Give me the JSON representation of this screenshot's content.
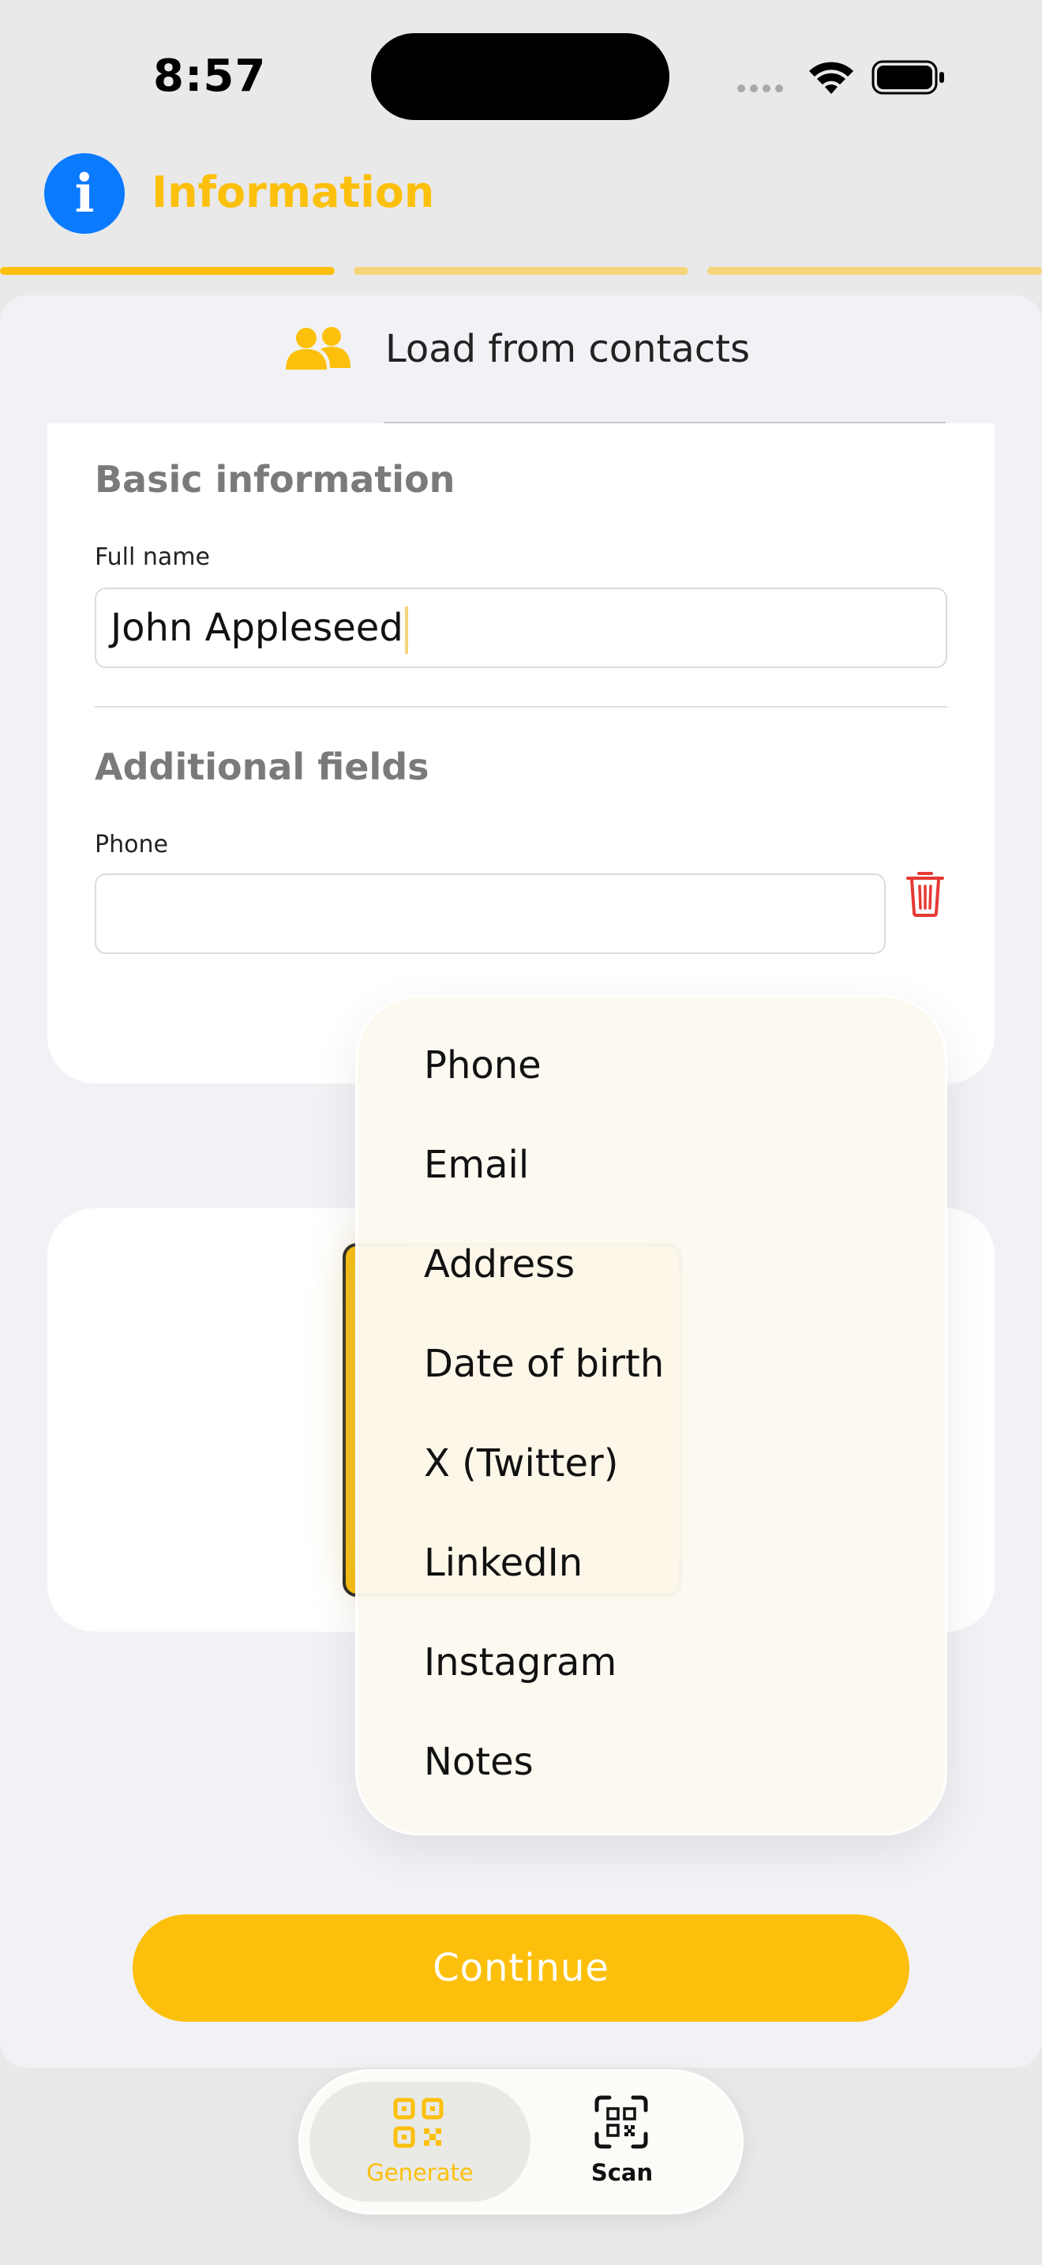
{
  "status_bar": {
    "time": "8:57"
  },
  "header": {
    "title": "Information",
    "info_icon": "info-icon",
    "steps_total": 3,
    "step_current": 1
  },
  "colors": {
    "accent": "#fcc00c",
    "accent_light": "#f6d47b",
    "info_blue": "#0a7aff",
    "delete_red": "#e53935"
  },
  "load_contacts": {
    "label": "Load from contacts",
    "icon": "people-icon"
  },
  "basic": {
    "title": "Basic information",
    "full_name": {
      "label": "Full name",
      "value": "John Appleseed"
    }
  },
  "additional": {
    "title": "Additional fields",
    "phone": {
      "label": "Phone",
      "value": ""
    }
  },
  "menu": {
    "items": [
      {
        "label": "Phone"
      },
      {
        "label": "Email"
      },
      {
        "label": "Address"
      },
      {
        "label": "Date of birth"
      },
      {
        "label": "X (Twitter)"
      },
      {
        "label": "LinkedIn"
      },
      {
        "label": "Instagram"
      },
      {
        "label": "Notes"
      }
    ]
  },
  "continue_label": "Continue",
  "tabs": [
    {
      "label": "Generate",
      "icon": "qrcode-icon",
      "selected": true
    },
    {
      "label": "Scan",
      "icon": "qr-scan-icon",
      "selected": false
    }
  ]
}
